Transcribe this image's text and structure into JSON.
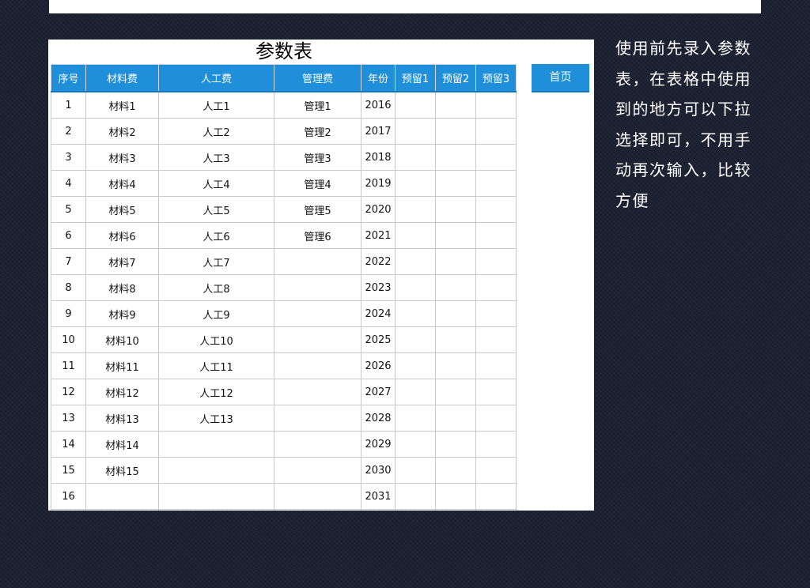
{
  "sheet": {
    "title": "参数表",
    "home_label": "首页",
    "columns": [
      "序号",
      "材料费",
      "人工费",
      "管理费",
      "年份",
      "预留1",
      "预留2",
      "预留3"
    ],
    "rows": [
      [
        "1",
        "材料1",
        "人工1",
        "管理1",
        "2016",
        "",
        "",
        ""
      ],
      [
        "2",
        "材料2",
        "人工2",
        "管理2",
        "2017",
        "",
        "",
        ""
      ],
      [
        "3",
        "材料3",
        "人工3",
        "管理3",
        "2018",
        "",
        "",
        ""
      ],
      [
        "4",
        "材料4",
        "人工4",
        "管理4",
        "2019",
        "",
        "",
        ""
      ],
      [
        "5",
        "材料5",
        "人工5",
        "管理5",
        "2020",
        "",
        "",
        ""
      ],
      [
        "6",
        "材料6",
        "人工6",
        "管理6",
        "2021",
        "",
        "",
        ""
      ],
      [
        "7",
        "材料7",
        "人工7",
        "",
        "2022",
        "",
        "",
        ""
      ],
      [
        "8",
        "材料8",
        "人工8",
        "",
        "2023",
        "",
        "",
        ""
      ],
      [
        "9",
        "材料9",
        "人工9",
        "",
        "2024",
        "",
        "",
        ""
      ],
      [
        "10",
        "材料10",
        "人工10",
        "",
        "2025",
        "",
        "",
        ""
      ],
      [
        "11",
        "材料11",
        "人工11",
        "",
        "2026",
        "",
        "",
        ""
      ],
      [
        "12",
        "材料12",
        "人工12",
        "",
        "2027",
        "",
        "",
        ""
      ],
      [
        "13",
        "材料13",
        "人工13",
        "",
        "2028",
        "",
        "",
        ""
      ],
      [
        "14",
        "材料14",
        "",
        "",
        "2029",
        "",
        "",
        ""
      ],
      [
        "15",
        "材料15",
        "",
        "",
        "2030",
        "",
        "",
        ""
      ],
      [
        "16",
        "",
        "",
        "",
        "2031",
        "",
        "",
        ""
      ],
      [
        "",
        "",
        "",
        "",
        "",
        "",
        "",
        ""
      ]
    ]
  },
  "note": {
    "lines": [
      "使用前先录入参数",
      "表，在表格中使用",
      "到的地方可以下拉",
      "选择即可，不用手",
      "动再次输入，比较",
      "方便"
    ]
  },
  "colors": {
    "header_blue": "#1e8fd8",
    "background": "#1c2233",
    "text_white": "#ffffff"
  }
}
